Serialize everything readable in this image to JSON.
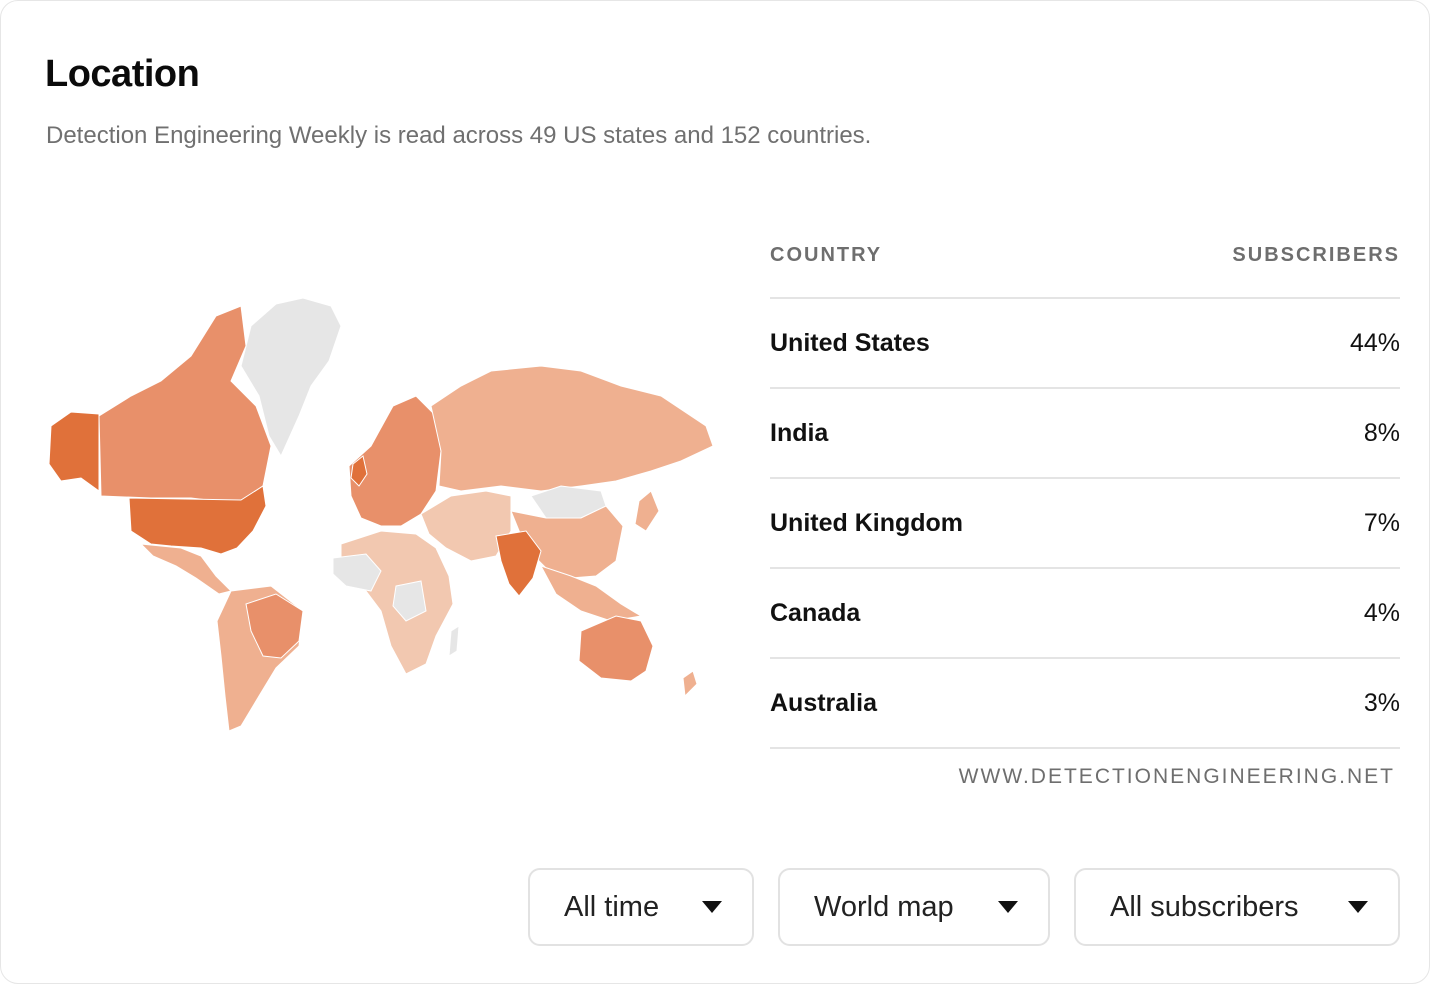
{
  "header": {
    "title": "Location",
    "subtitle": "Detection Engineering Weekly is read across 49 US states and 152 countries."
  },
  "colors": {
    "highest": "#e0713a",
    "high": "#e8906a",
    "medium": "#efb090",
    "low": "#f2c8b0",
    "no_data": "#e6e6e6"
  },
  "table": {
    "col_country": "COUNTRY",
    "col_subscribers": "SUBSCRIBERS",
    "rows": [
      {
        "country": "United States",
        "subscribers": "44%"
      },
      {
        "country": "India",
        "subscribers": "8%"
      },
      {
        "country": "United Kingdom",
        "subscribers": "7%"
      },
      {
        "country": "Canada",
        "subscribers": "4%"
      },
      {
        "country": "Australia",
        "subscribers": "3%"
      }
    ],
    "source": "WWW.DETECTIONENGINEERING.NET"
  },
  "filters": {
    "time": "All time",
    "view": "World map",
    "audience": "All subscribers"
  }
}
